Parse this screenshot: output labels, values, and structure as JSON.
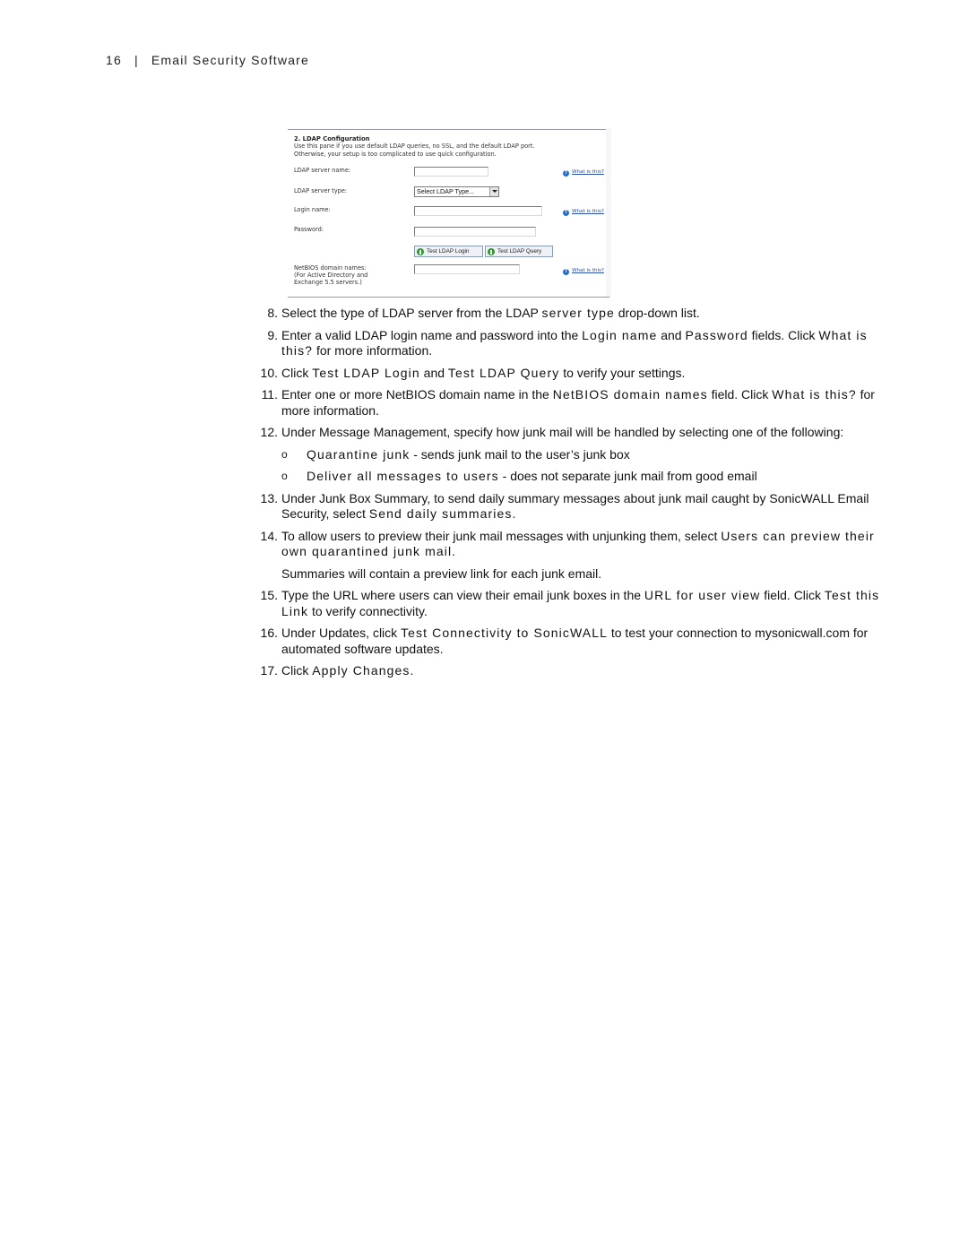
{
  "running_head": {
    "page_number": "16",
    "separator": "|",
    "title": "Email Security Software"
  },
  "screenshot": {
    "section_title": "2. LDAP Configuration",
    "description_line1": "Use this pane if you use default LDAP queries, no SSL, and the default LDAP port.",
    "description_line2": "Otherwise, your setup is too complicated to use quick configuration.",
    "fields": {
      "server_name_label": "LDAP server name:",
      "server_name_value": "",
      "server_type_label": "LDAP server type:",
      "server_type_selected": "Select LDAP Type...",
      "login_name_label": "Login name:",
      "login_name_value": "",
      "password_label": "Password:",
      "password_value": "",
      "netbios_label_line1": "NetBIOS domain names:",
      "netbios_label_line2": "(For Active Directory and",
      "netbios_label_line3": "Exchange 5.5 servers.)",
      "netbios_value": ""
    },
    "help_link": "What is this?",
    "buttons": {
      "test_login": "Test LDAP Login",
      "test_query": "Test LDAP Query"
    },
    "icons": {
      "help": "question-circle-icon",
      "button": "green-go-icon"
    },
    "colors": {
      "help_link": "#2a4fa8",
      "go_icon": "#2f9a2f",
      "frame_line": "#9a9aa6"
    }
  },
  "steps": [
    {
      "num": "8.",
      "parts": [
        "Select the type of LDAP server from the LDAP ",
        "server type",
        " drop-down list."
      ]
    },
    {
      "num": "9.",
      "parts": [
        "Enter a valid LDAP login name and password into the ",
        "Login name",
        " and ",
        "Password",
        " fields. Click ",
        "What is this?",
        " for more information."
      ]
    },
    {
      "num": "10.",
      "parts": [
        "Click ",
        "Test LDAP Login",
        " and ",
        "Test LDAP Query",
        " to verify your settings."
      ]
    },
    {
      "num": "11.",
      "parts": [
        "Enter one or more NetBIOS domain name in the ",
        "NetBIOS domain names",
        " field. Click ",
        "What is this?",
        " for more information."
      ]
    },
    {
      "num": "12.",
      "parts": [
        "Under Message Management, specify how junk mail will be handled by selecting one of the following:"
      ]
    },
    {
      "num": "13.",
      "parts": [
        "Under Junk Box Summary, to send daily summary messages about junk mail caught by SonicWALL Email Security, select ",
        "Send daily summaries",
        "."
      ]
    },
    {
      "num": "14.",
      "parts": [
        "To allow users to preview their junk mail messages with unjunking them, select ",
        "Users can preview their own quarantined junk mail",
        "."
      ]
    },
    {
      "num": "15.",
      "parts": [
        "Type the URL where users can view their email junk boxes in the ",
        "URL for user view",
        " field. Click ",
        "Test this Link",
        " to verify connectivity."
      ]
    },
    {
      "num": "16.",
      "parts": [
        "Under Updates, click ",
        "Test Connectivity to SonicWALL",
        " to test your connection to mysonicwall.com for automated software updates."
      ]
    },
    {
      "num": "17.",
      "parts": [
        "Click ",
        "Apply Changes",
        "."
      ]
    }
  ],
  "bullets": [
    {
      "marker": "o",
      "term": "Quarantine junk",
      "text": " - sends junk mail to the user’s junk box"
    },
    {
      "marker": "o",
      "term": "Deliver all messages to users",
      "text": " - does not separate junk mail from good email"
    }
  ],
  "step14_note": "Summaries will contain a preview link for each junk email."
}
